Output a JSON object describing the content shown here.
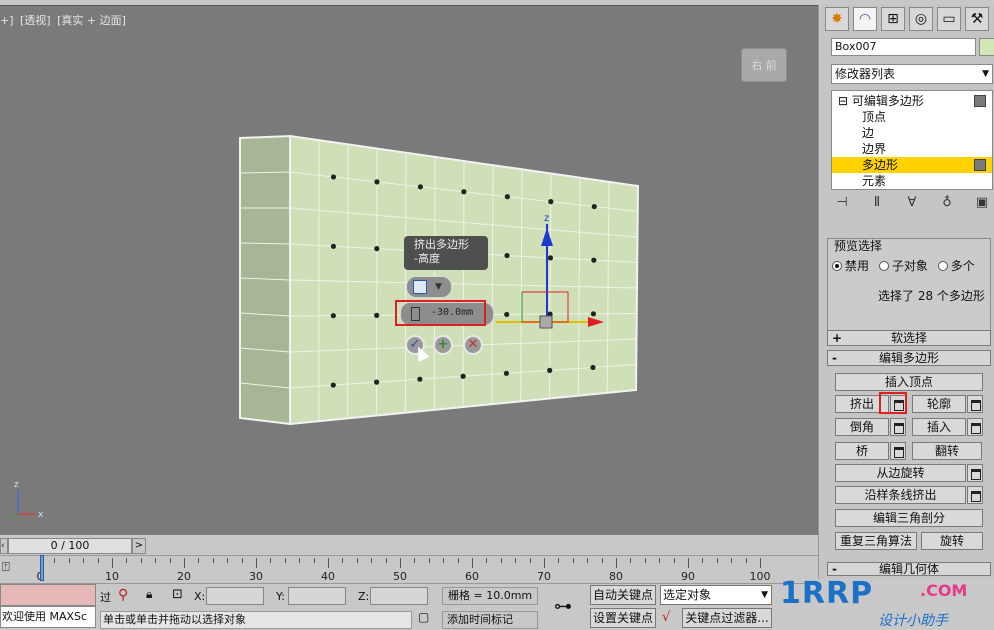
{
  "viewport": {
    "label_parts": [
      "+]",
      "[透视]",
      "[真实 + 边面]"
    ],
    "viewcube_label": "右 前",
    "caddy": {
      "title": "挤出多边形",
      "subtitle": "-高度",
      "height_value": "-30.0mm"
    }
  },
  "command_panel": {
    "tab_icons": [
      "create-icon",
      "modify-icon",
      "hierarchy-icon",
      "motion-icon",
      "display-icon",
      "utilities-icon"
    ],
    "object_name": "Box007",
    "object_color": "#d3e7b5",
    "modifier_list": "修改器列表",
    "stack": [
      {
        "label": "⊟ 可编辑多边形",
        "selected": false
      },
      {
        "label": "顶点",
        "selected": false
      },
      {
        "label": "边",
        "selected": false
      },
      {
        "label": "边界",
        "selected": false
      },
      {
        "label": "多边形",
        "selected": true
      },
      {
        "label": "元素",
        "selected": false
      }
    ],
    "preview_selection": {
      "title": "预览选择",
      "options": [
        "禁用",
        "子对象",
        "多个"
      ],
      "selected": "禁用",
      "status": "选择了 28 个多边形"
    },
    "soft_selection": "软选择",
    "edit_polygons": {
      "title": "编辑多边形",
      "insert_vertex": "插入顶点",
      "extrude": "挤出",
      "outline": "轮廓",
      "bevel": "倒角",
      "inset": "插入",
      "bridge": "桥",
      "flip": "翻转",
      "hinge_from_edge": "从边旋转",
      "extrude_along_spline": "沿样条线挤出",
      "edit_triangulation": "编辑三角剖分",
      "retriangulate": "重复三角算法",
      "turn": "旋转"
    },
    "edit_geometry": "编辑几何体"
  },
  "timeline": {
    "frame": "0 / 100",
    "ticks": [
      "0",
      "10",
      "20",
      "30",
      "40",
      "50",
      "60",
      "70",
      "80",
      "90",
      "100"
    ]
  },
  "status": {
    "maxscript": "欢迎使用 MAXSc",
    "prompt": "单击或单击并拖动以选择对象",
    "x_label": "X:",
    "y_label": "Y:",
    "z_label": "Z:",
    "grid": "栅格 = 10.0mm",
    "add_time_tag": "添加时间标记",
    "auto_key": "自动关键点",
    "set_key": "设置关键点",
    "selection_filter": "选定对象",
    "key_filters": "关键点过滤器...",
    "mode_prefix": "过"
  },
  "watermark": {
    "main": "1RRP",
    "dotcom": ".COM",
    "sub": "设计小助手"
  },
  "colors": {
    "viewport_bg": "#7a7a7a",
    "box_face": "#cfe0b8",
    "selected_stack": "#ffd200",
    "highlight_frame": "#e02020",
    "gizmo_x": "#e02020",
    "gizmo_y": "#2a8a2a",
    "gizmo_z": "#1a3ad0"
  }
}
